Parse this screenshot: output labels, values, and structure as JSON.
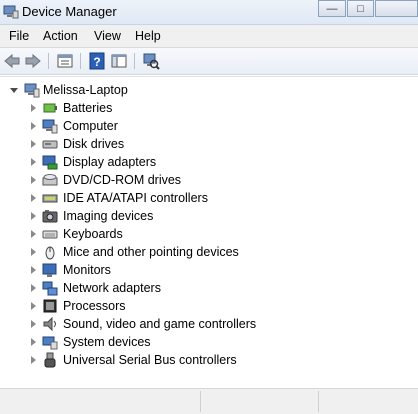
{
  "window": {
    "title": "Device Manager"
  },
  "window_controls": {
    "minimize": "—",
    "maximize": "□"
  },
  "menu": [
    "File",
    "Action",
    "View",
    "Help"
  ],
  "toolbar": [
    "back-icon",
    "forward-icon",
    "properties-icon",
    "help-icon",
    "console-tree-icon",
    "scan-hardware-icon"
  ],
  "tree": {
    "root": "Melissa-Laptop",
    "items": [
      {
        "label": "Batteries",
        "icon": "battery-icon"
      },
      {
        "label": "Computer",
        "icon": "computer-icon"
      },
      {
        "label": "Disk drives",
        "icon": "disk-drive-icon"
      },
      {
        "label": "Display adapters",
        "icon": "display-adapter-icon"
      },
      {
        "label": "DVD/CD-ROM drives",
        "icon": "dvd-drive-icon"
      },
      {
        "label": "IDE ATA/ATAPI controllers",
        "icon": "ide-controller-icon"
      },
      {
        "label": "Imaging devices",
        "icon": "camera-icon"
      },
      {
        "label": "Keyboards",
        "icon": "keyboard-icon"
      },
      {
        "label": "Mice and other pointing devices",
        "icon": "mouse-icon"
      },
      {
        "label": "Monitors",
        "icon": "monitor-icon"
      },
      {
        "label": "Network adapters",
        "icon": "network-adapter-icon"
      },
      {
        "label": "Processors",
        "icon": "processor-icon"
      },
      {
        "label": "Sound, video and game controllers",
        "icon": "speaker-icon"
      },
      {
        "label": "System devices",
        "icon": "system-devices-icon"
      },
      {
        "label": "Universal Serial Bus controllers",
        "icon": "usb-icon"
      }
    ]
  }
}
